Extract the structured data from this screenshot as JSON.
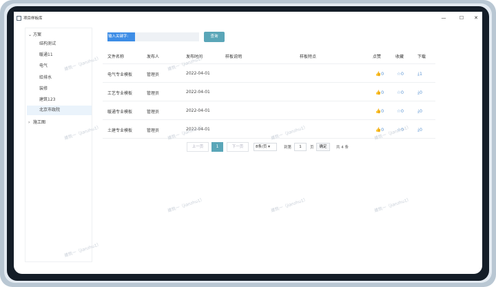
{
  "window": {
    "title": "项目样板库"
  },
  "window_controls": {
    "minimize": "—",
    "maximize": "☐",
    "close": "✕"
  },
  "sidebar": {
    "groups": [
      {
        "label": "方案",
        "expanded": true,
        "items": [
          {
            "label": "结构测试"
          },
          {
            "label": "暖通11"
          },
          {
            "label": "电气"
          },
          {
            "label": "给排水"
          },
          {
            "label": "装修"
          },
          {
            "label": "建筑123"
          },
          {
            "label": "北京市政院",
            "selected": true
          }
        ]
      },
      {
        "label": "施工图",
        "expanded": false
      }
    ]
  },
  "search": {
    "label": "输入关键字:",
    "value": "",
    "button": "查询"
  },
  "table": {
    "headers": [
      "文件名称",
      "发布人",
      "发布时间",
      "样板说明",
      "样板特点",
      "点赞",
      "收藏",
      "下载"
    ],
    "rows": [
      {
        "name": "电气专业模板",
        "publisher": "管理员",
        "date": "2022-04-01",
        "desc": "",
        "feature": "",
        "likes": "0",
        "favorites": "0",
        "downloads": "1"
      },
      {
        "name": "工艺专业模板",
        "publisher": "管理员",
        "date": "2022-04-01",
        "desc": "",
        "feature": "",
        "likes": "0",
        "favorites": "0",
        "downloads": "0"
      },
      {
        "name": "暖通专业模板",
        "publisher": "管理员",
        "date": "2022-04-01",
        "desc": "",
        "feature": "",
        "likes": "0",
        "favorites": "0",
        "downloads": "0"
      },
      {
        "name": "土建专业模板",
        "publisher": "管理员",
        "date": "2022-04-01",
        "desc": "",
        "feature": "",
        "likes": "0",
        "favorites": "0",
        "downloads": "0"
      }
    ]
  },
  "icons": {
    "like": "thumb-up-icon",
    "favorite": "star-icon",
    "download": "download-icon"
  },
  "pager": {
    "prev": "上一页",
    "current": "1",
    "next": "下一页",
    "page_size": "8条/页",
    "goto_label": "到第",
    "goto_value": "1",
    "page_unit": "页",
    "confirm": "确定",
    "total": "共 4 条"
  },
  "watermark": "建筑一（jianzhu1）",
  "colors": {
    "accent": "#5aa6b8",
    "label_blue": "#3d8de6",
    "icon_blue": "#5b95d3",
    "selected_bg": "#eaf3fb"
  }
}
